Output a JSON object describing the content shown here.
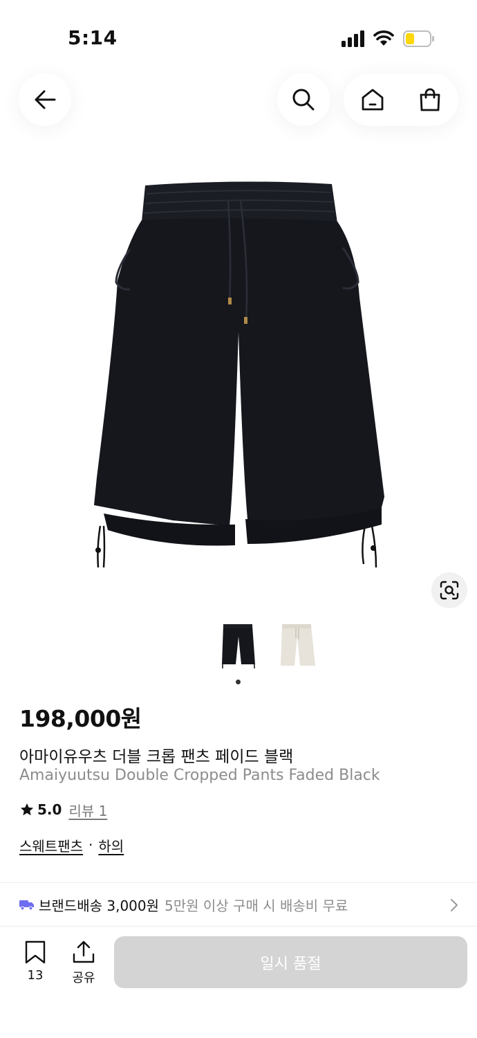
{
  "status_bar": {
    "time": "5:14",
    "icons": [
      "cellular-signal-icon",
      "wifi-icon",
      "battery-icon"
    ],
    "battery_color": "#ffd60a"
  },
  "header": {
    "icons": [
      "back-arrow-icon",
      "search-icon",
      "home-icon",
      "shopping-bag-icon"
    ]
  },
  "product": {
    "price": "198,000원",
    "name_ko": "아마이유우츠 더블 크롭 팬츠 페이드 블랙",
    "name_en": "Amaiyuutsu Double Cropped Pants Faded Black",
    "rating": "5.0",
    "review_label": "리뷰 1",
    "categories": [
      "스웨트팬츠",
      "하의"
    ],
    "category_separator": "·",
    "thumbnail_count": 2,
    "selected_thumbnail": 1
  },
  "shipping": {
    "label": "브랜드배송 3,000원",
    "note": "5만원 이상 구매 시 배송비 무료",
    "accent_color": "#6e6cf0"
  },
  "bottom_bar": {
    "save_count": "13",
    "share_label": "공유",
    "soldout_label": "일시 품절",
    "soldout_color": "#d4d4d4"
  }
}
